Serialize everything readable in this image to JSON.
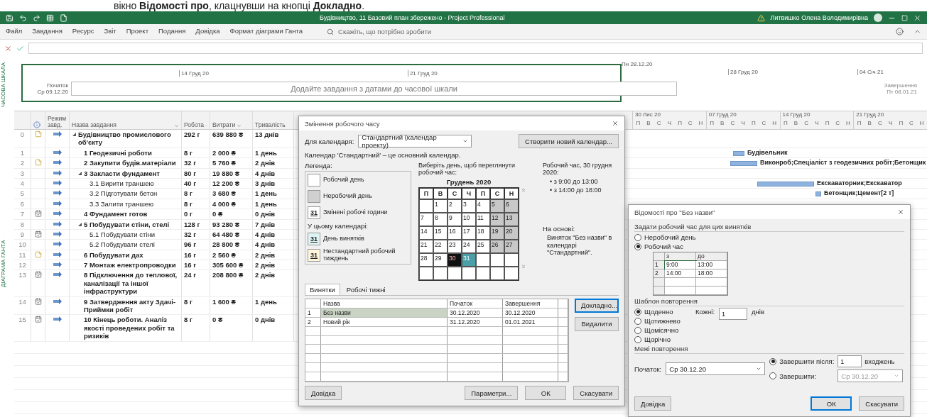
{
  "caption": "вікно **Відомості про**, клацнувши на кнопці **Докладно**.",
  "title_bar": {
    "title": "Будівництво, 11 Базовий план збережено - Project Professional",
    "user": "Литвишко Олена Володимирівна"
  },
  "menu": [
    {
      "label": "Файл",
      "selected": false
    },
    {
      "label": "Завдання",
      "selected": false
    },
    {
      "label": "Ресурс",
      "selected": false
    },
    {
      "label": "Звіт",
      "selected": false
    },
    {
      "label": "Проект",
      "selected": false
    },
    {
      "label": "Подання",
      "selected": false
    },
    {
      "label": "Довідка",
      "selected": false
    },
    {
      "label": "Формат діаграми Ганта",
      "selected": false
    }
  ],
  "search": {
    "placeholder": "Скажіть, що потрібно зробити"
  },
  "timeline": {
    "label": "ЧАСОВА ШКАЛА",
    "start_label": "Початок",
    "start_date": "Ср 09.12.20",
    "today": "Пн 28.12.20",
    "ticks": [
      "14 Груд 20",
      "21 Груд 20"
    ],
    "ticks_outside": [
      "28 Груд 20",
      "04 Січ 21"
    ],
    "placeholder": "Додайте завдання з датами до часової шкали",
    "end_label": "Завершення",
    "end_date": "Пт 08.01.21"
  },
  "gantt_label": "ДІАГРАМА ГАНТА",
  "columns": {
    "mode": "Режим завд.",
    "name": "Назва завдання",
    "work": "Робота",
    "cost": "Витрати",
    "duration": "Тривалість"
  },
  "gantt_weeks": [
    {
      "label": "30 Лис 20",
      "days": [
        "П",
        "В",
        "С",
        "Ч",
        "П",
        "С",
        "Н"
      ]
    },
    {
      "label": "07 Груд 20",
      "days": [
        "П",
        "В",
        "С",
        "Ч",
        "П",
        "С",
        "Н"
      ]
    },
    {
      "label": "14 Груд 20",
      "days": [
        "П",
        "В",
        "С",
        "Ч",
        "П",
        "С",
        "Н"
      ]
    },
    {
      "label": "21 Груд 20",
      "days": [
        "П",
        "В",
        "С",
        "Ч",
        "П",
        "С",
        "Н"
      ]
    }
  ],
  "tasks": [
    {
      "id": "0",
      "kind": "note",
      "name": "Будівництво промислового об'єкту",
      "work": "292 г",
      "cost": "639 880 ₴",
      "duration": "13 днів",
      "expanded": true,
      "children": [
        {
          "id": "1",
          "kind": "plain",
          "name": "1 Геодезичні роботи",
          "work": "8 г",
          "cost": "2 000 ₴",
          "duration": "1 день",
          "resources": "Будівельник"
        },
        {
          "id": "2",
          "kind": "note",
          "name": "2 Закупити будів.матеріали",
          "work": "32 г",
          "cost": "5 760 ₴",
          "duration": "2 днів",
          "resources": "Виконроб;Спеціаліст з геодезичних робіт;Бетонщик"
        },
        {
          "id": "3",
          "kind": "plain",
          "name": "3 Закласти фундамент",
          "work": "80 г",
          "cost": "19 880 ₴",
          "duration": "4 днів",
          "expanded": true,
          "children": [
            {
              "id": "4",
              "kind": "plain",
              "name": "3.1 Вирити траншею",
              "work": "40 г",
              "cost": "12 200 ₴",
              "duration": "3 днів",
              "resources": "Екскаваторник;Екскаватор"
            },
            {
              "id": "5",
              "kind": "plain",
              "name": "3.2 Підготувати бетон",
              "work": "8 г",
              "cost": "3 680 ₴",
              "duration": "1 день",
              "resources": "Бетонщик;Цемент[2 т]"
            },
            {
              "id": "6",
              "kind": "plain",
              "name": "3.3 Залити траншею",
              "work": "8 г",
              "cost": "4 000 ₴",
              "duration": "1 день"
            }
          ]
        },
        {
          "id": "7",
          "kind": "calendar",
          "name": "4 Фундамент готов",
          "work": "0 г",
          "cost": "0 ₴",
          "duration": "0 днів"
        },
        {
          "id": "8",
          "kind": "plain",
          "name": "5 Побудувати стіни, стелі",
          "work": "128 г",
          "cost": "93 280 ₴",
          "duration": "7 днів",
          "expanded": true,
          "children": [
            {
              "id": "9",
              "kind": "calendar",
              "name": "5.1 Побудувати стіни",
              "work": "32 г",
              "cost": "64 480 ₴",
              "duration": "4 днів"
            },
            {
              "id": "10",
              "kind": "plain",
              "name": "5.2 Побудувати стелі",
              "work": "96 г",
              "cost": "28 800 ₴",
              "duration": "4 днів"
            }
          ]
        },
        {
          "id": "11",
          "kind": "note",
          "name": "6 Побудувати дах",
          "work": "16 г",
          "cost": "2 560 ₴",
          "duration": "2 днів"
        },
        {
          "id": "12",
          "kind": "plain",
          "name": "7 Монтаж електропроводки",
          "work": "16 г",
          "cost": "305 600 ₴",
          "duration": "2 днів"
        },
        {
          "id": "13",
          "kind": "calendar",
          "name": "8 Підключення до теплової, каналізації та іншої інфраструктури",
          "work": "24 г",
          "cost": "208 800 ₴",
          "duration": "2 днів"
        },
        {
          "id": "14",
          "kind": "calendar",
          "name": "9 Затвердження акту Здачі-Приймки робіт",
          "work": "8 г",
          "cost": "1 600 ₴",
          "duration": "1 день"
        },
        {
          "id": "15",
          "kind": "calendar",
          "name": "10 Кінець роботи. Аналіз якості проведених робіт та ризиків",
          "work": "8 г",
          "cost": "0 ₴",
          "duration": "0 днів"
        }
      ]
    }
  ],
  "calendar_dialog": {
    "title": "Змінення робочого часу",
    "for_label": "Для календаря:",
    "calendar": "Стандартний (календар проекту)",
    "create_button": "Створити новий календар...",
    "note": "Календар 'Стандартний' – це основний календар.",
    "legend_title": "Легенда:",
    "legend": [
      {
        "kind": "work",
        "label": "Робочий день"
      },
      {
        "kind": "nonwork",
        "label": "Неробочий день"
      },
      {
        "kind": "changed",
        "swatch": "31",
        "label": "Змінені робочі години"
      },
      {
        "kind": "heading",
        "label": "У цьому календарі:"
      },
      {
        "kind": "exception",
        "swatch": "31",
        "label": "День винятків"
      },
      {
        "kind": "nonstandard",
        "swatch": "31",
        "label": "Нестандартний робочий тиждень"
      }
    ],
    "prompt": "Виберіть день, щоб переглянути робочий час:",
    "month": "Грудень 2020",
    "weekdays": [
      "П",
      "В",
      "С",
      "Ч",
      "П",
      "С",
      "Н"
    ],
    "weeks": [
      [
        {
          "kind": "blank"
        },
        {
          "day": "1",
          "kind": "work",
          "selected": false
        },
        {
          "day": "2",
          "kind": "work",
          "selected": false
        },
        {
          "day": "3",
          "kind": "work",
          "selected": false
        },
        {
          "day": "4",
          "kind": "work",
          "selected": false
        },
        {
          "day": "5",
          "kind": "nonwork",
          "selected": false
        },
        {
          "day": "6",
          "kind": "nonwork",
          "selected": false
        }
      ],
      [
        {
          "day": "7",
          "kind": "work",
          "selected": false
        },
        {
          "day": "8",
          "kind": "work",
          "selected": false
        },
        {
          "day": "9",
          "kind": "work",
          "selected": false
        },
        {
          "day": "10",
          "kind": "work",
          "selected": false
        },
        {
          "day": "11",
          "kind": "work",
          "selected": false
        },
        {
          "day": "12",
          "kind": "nonwork",
          "selected": false
        },
        {
          "day": "13",
          "kind": "nonwork",
          "selected": false
        }
      ],
      [
        {
          "day": "14",
          "kind": "work",
          "selected": false
        },
        {
          "day": "15",
          "kind": "work",
          "selected": false
        },
        {
          "day": "16",
          "kind": "work",
          "selected": false
        },
        {
          "day": "17",
          "kind": "work",
          "selected": false
        },
        {
          "day": "18",
          "kind": "work",
          "selected": false
        },
        {
          "day": "19",
          "kind": "nonwork",
          "selected": false
        },
        {
          "day": "20",
          "kind": "nonwork",
          "selected": false
        }
      ],
      [
        {
          "day": "21",
          "kind": "work",
          "selected": false
        },
        {
          "day": "22",
          "kind": "work",
          "selected": false
        },
        {
          "day": "23",
          "kind": "work",
          "selected": false
        },
        {
          "day": "24",
          "kind": "work",
          "selected": false
        },
        {
          "day": "25",
          "kind": "work",
          "selected": false
        },
        {
          "day": "26",
          "kind": "nonwork",
          "selected": false
        },
        {
          "day": "27",
          "kind": "nonwork",
          "selected": false
        }
      ],
      [
        {
          "day": "28",
          "kind": "work",
          "selected": false
        },
        {
          "day": "29",
          "kind": "work",
          "selected": false
        },
        {
          "day": "30",
          "kind": "exception",
          "selected": true
        },
        {
          "day": "31",
          "kind": "exception",
          "selected": false
        },
        {
          "kind": "blank"
        },
        {
          "kind": "blank"
        },
        {
          "kind": "blank"
        }
      ],
      [
        {
          "kind": "blank"
        },
        {
          "kind": "blank"
        },
        {
          "kind": "blank"
        },
        {
          "kind": "blank"
        },
        {
          "kind": "blank"
        },
        {
          "kind": "blank"
        },
        {
          "kind": "blank"
        }
      ]
    ],
    "worktime_title": "Робочий час, 30 грудня 2020:",
    "worktime": [
      "• з 9:00 до 13:00",
      "• з 14:00 до 18:00"
    ],
    "based_on_label": "На основі:",
    "based_on": "Виняток \"Без назви\" в календарі \"Стандартний\".",
    "tabs": [
      {
        "label": "Винятки",
        "selected": true
      },
      {
        "label": "Робочі тижні",
        "selected": false
      }
    ],
    "columns": [
      "Назва",
      "Початок",
      "Завершення"
    ],
    "rows": [
      {
        "num": "1",
        "name": "Без назви",
        "start": "30.12.2020",
        "end": "30.12.2020",
        "selected": true
      },
      {
        "num": "2",
        "name": "Новий рік",
        "start": "31.12.2020",
        "end": "01.01.2021",
        "selected": false
      }
    ],
    "side_buttons": [
      {
        "label": "Докладно...",
        "focused": true
      },
      {
        "label": "Видалити",
        "focused": false
      }
    ],
    "help_button": "Довідка",
    "buttons": [
      {
        "label": "Параметри...",
        "focused": false
      },
      {
        "label": "ОК",
        "focused": false
      },
      {
        "label": "Скасувати",
        "focused": false
      }
    ]
  },
  "details_dialog": {
    "title": "Відомості про \"Без назви\"",
    "worktime_heading": "Задати робочий час для цих винятків",
    "worktime_options": [
      {
        "label": "Неробочий день",
        "selected": false
      },
      {
        "label": "Робочий час",
        "selected": true
      }
    ],
    "time_columns": [
      "з",
      "до"
    ],
    "times": [
      {
        "num": "1",
        "from": "9:00",
        "to": "13:00"
      },
      {
        "num": "2",
        "from": "14:00",
        "to": "18:00"
      }
    ],
    "pattern_heading": "Шаблон повторення",
    "pattern_options": [
      {
        "label": "Щоденно",
        "selected": true
      },
      {
        "label": "Щотижнево",
        "selected": false
      },
      {
        "label": "Щомісячно",
        "selected": false
      },
      {
        "label": "Щорічно",
        "selected": false
      }
    ],
    "every_label": "Кожні:",
    "every_value": "1",
    "every_unit": "днів",
    "range_heading": "Межі повторення",
    "start_label": "Початок:",
    "start_value": "Ср 30.12.20",
    "end_options": [
      {
        "label": "Завершити після:",
        "selected": true,
        "value": "1",
        "unit": "входжень"
      },
      {
        "label": "Завершити:",
        "selected": false,
        "value": "Ср 30.12.20"
      }
    ],
    "help_button": "Довідка",
    "buttons": [
      {
        "label": "ОК",
        "focused": true
      },
      {
        "label": "Скасувати",
        "focused": false
      }
    ]
  }
}
